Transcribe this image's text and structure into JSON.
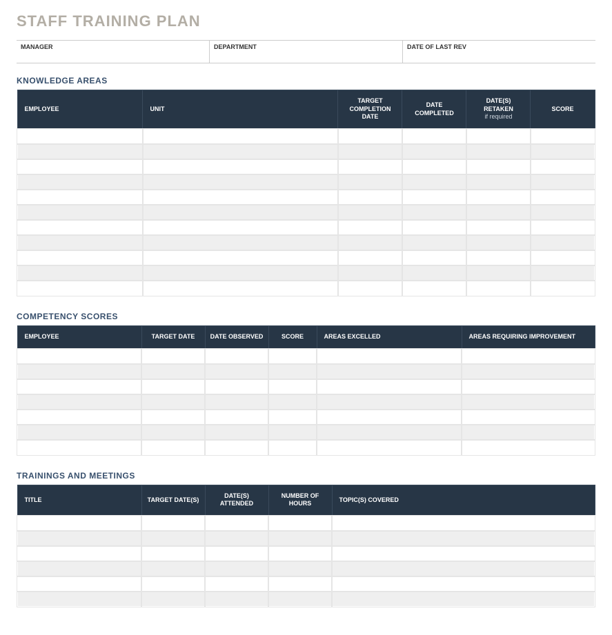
{
  "title": "STAFF TRAINING PLAN",
  "meta": {
    "manager_label": "MANAGER",
    "department_label": "DEPARTMENT",
    "last_rev_label": "DATE OF LAST REV",
    "manager_value": "",
    "department_value": "",
    "last_rev_value": ""
  },
  "knowledge": {
    "heading": "KNOWLEDGE AREAS",
    "headers": {
      "employee": "EMPLOYEE",
      "unit": "UNIT",
      "target_completion": "TARGET COMPLETION DATE",
      "date_completed": "DATE COMPLETED",
      "dates_retaken": "DATE(S) RETAKEN",
      "dates_retaken_sub": "if required",
      "score": "SCORE"
    },
    "rows": [
      {
        "employee": "",
        "unit": "",
        "target_completion": "",
        "date_completed": "",
        "dates_retaken": "",
        "score": ""
      },
      {
        "employee": "",
        "unit": "",
        "target_completion": "",
        "date_completed": "",
        "dates_retaken": "",
        "score": ""
      },
      {
        "employee": "",
        "unit": "",
        "target_completion": "",
        "date_completed": "",
        "dates_retaken": "",
        "score": ""
      },
      {
        "employee": "",
        "unit": "",
        "target_completion": "",
        "date_completed": "",
        "dates_retaken": "",
        "score": ""
      },
      {
        "employee": "",
        "unit": "",
        "target_completion": "",
        "date_completed": "",
        "dates_retaken": "",
        "score": ""
      },
      {
        "employee": "",
        "unit": "",
        "target_completion": "",
        "date_completed": "",
        "dates_retaken": "",
        "score": ""
      },
      {
        "employee": "",
        "unit": "",
        "target_completion": "",
        "date_completed": "",
        "dates_retaken": "",
        "score": ""
      },
      {
        "employee": "",
        "unit": "",
        "target_completion": "",
        "date_completed": "",
        "dates_retaken": "",
        "score": ""
      },
      {
        "employee": "",
        "unit": "",
        "target_completion": "",
        "date_completed": "",
        "dates_retaken": "",
        "score": ""
      },
      {
        "employee": "",
        "unit": "",
        "target_completion": "",
        "date_completed": "",
        "dates_retaken": "",
        "score": ""
      },
      {
        "employee": "",
        "unit": "",
        "target_completion": "",
        "date_completed": "",
        "dates_retaken": "",
        "score": ""
      }
    ]
  },
  "competency": {
    "heading": "COMPETENCY SCORES",
    "headers": {
      "employee": "EMPLOYEE",
      "target_date": "TARGET DATE",
      "date_observed": "DATE OBSERVED",
      "score": "SCORE",
      "areas_excelled": "AREAS EXCELLED",
      "areas_improve": "AREAS REQUIRING IMPROVEMENT"
    },
    "rows": [
      {
        "employee": "",
        "target_date": "",
        "date_observed": "",
        "score": "",
        "areas_excelled": "",
        "areas_improve": ""
      },
      {
        "employee": "",
        "target_date": "",
        "date_observed": "",
        "score": "",
        "areas_excelled": "",
        "areas_improve": ""
      },
      {
        "employee": "",
        "target_date": "",
        "date_observed": "",
        "score": "",
        "areas_excelled": "",
        "areas_improve": ""
      },
      {
        "employee": "",
        "target_date": "",
        "date_observed": "",
        "score": "",
        "areas_excelled": "",
        "areas_improve": ""
      },
      {
        "employee": "",
        "target_date": "",
        "date_observed": "",
        "score": "",
        "areas_excelled": "",
        "areas_improve": ""
      },
      {
        "employee": "",
        "target_date": "",
        "date_observed": "",
        "score": "",
        "areas_excelled": "",
        "areas_improve": ""
      },
      {
        "employee": "",
        "target_date": "",
        "date_observed": "",
        "score": "",
        "areas_excelled": "",
        "areas_improve": ""
      }
    ]
  },
  "trainings": {
    "heading": "TRAININGS AND MEETINGS",
    "headers": {
      "title": "TITLE",
      "target_dates": "TARGET DATE(S)",
      "dates_attended": "DATE(S) ATTENDED",
      "hours": "NUMBER OF HOURS",
      "topics": "TOPIC(S) COVERED"
    },
    "rows": [
      {
        "title": "",
        "target_dates": "",
        "dates_attended": "",
        "hours": "",
        "topics": ""
      },
      {
        "title": "",
        "target_dates": "",
        "dates_attended": "",
        "hours": "",
        "topics": ""
      },
      {
        "title": "",
        "target_dates": "",
        "dates_attended": "",
        "hours": "",
        "topics": ""
      },
      {
        "title": "",
        "target_dates": "",
        "dates_attended": "",
        "hours": "",
        "topics": ""
      },
      {
        "title": "",
        "target_dates": "",
        "dates_attended": "",
        "hours": "",
        "topics": ""
      },
      {
        "title": "",
        "target_dates": "",
        "dates_attended": "",
        "hours": "",
        "topics": ""
      }
    ]
  }
}
